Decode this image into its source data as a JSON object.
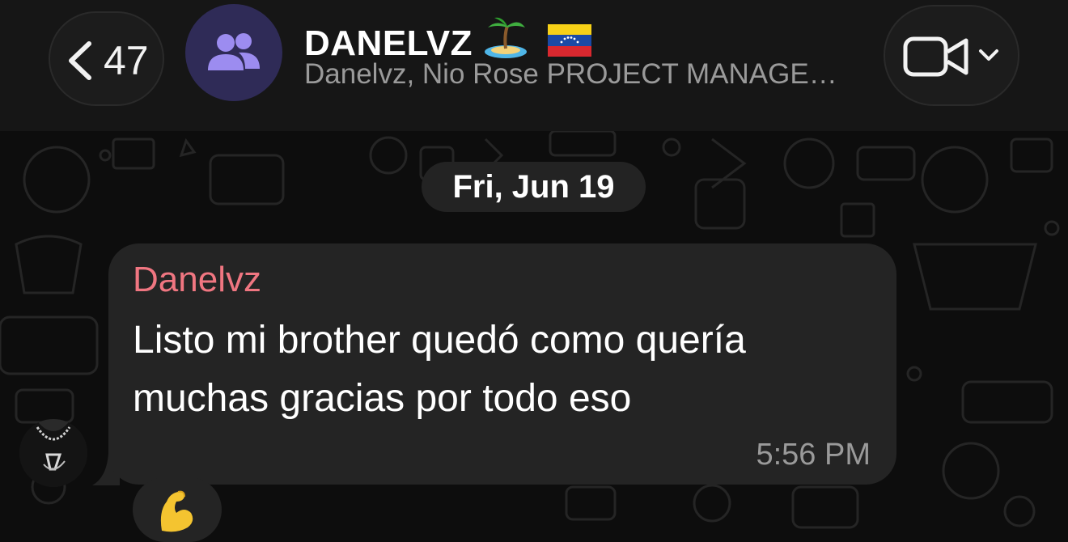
{
  "header": {
    "back_count": "47",
    "title": "DANELVZ",
    "subtitle": "Danelvz, Nio Rose PROJECT MANAGE…"
  },
  "chat": {
    "date_label": "Fri, Jun 19",
    "message": {
      "sender": "Danelvz",
      "line1": "Listo mi brother quedó como quería",
      "line2": "muchas gracias por todo eso",
      "time": "5:56 PM"
    },
    "reaction": "flexed-biceps"
  },
  "colors": {
    "background": "#0d0d0d",
    "header": "#161616",
    "bubble": "#242424",
    "sender": "#f07681",
    "avatar_group": "#2f2b57",
    "avatar_icon": "#9c8cf0"
  },
  "icons": [
    "chevron-left-icon",
    "group-icon",
    "palm-island-emoji",
    "venezuela-flag-emoji",
    "video-camera-icon",
    "chevron-down-icon",
    "flexed-biceps-emoji"
  ]
}
